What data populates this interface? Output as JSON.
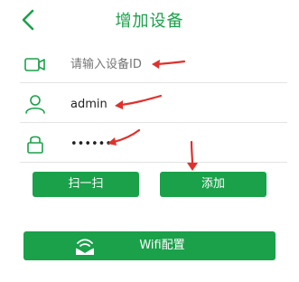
{
  "header": {
    "title": "增加设备",
    "back_icon": "chevron-left-icon"
  },
  "form": {
    "device_id": {
      "icon": "camera-icon",
      "placeholder": "请输入设备ID",
      "value": ""
    },
    "username": {
      "icon": "user-icon",
      "value": "admin"
    },
    "password": {
      "icon": "lock-icon",
      "value": "••••••"
    }
  },
  "actions": {
    "scan_label": "扫一扫",
    "add_label": "添加",
    "wifi_label": "Wifi配置",
    "wifi_icon": "wifi-envelope-icon"
  },
  "colors": {
    "accent": "#1aa14a",
    "annotation": "#e0312c",
    "divider": "#e3e3e3",
    "placeholder": "#c9c9c9"
  }
}
